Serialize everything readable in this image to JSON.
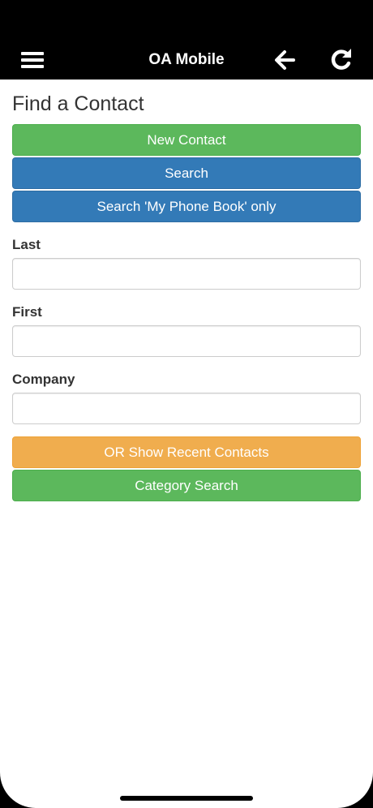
{
  "header": {
    "title": "OA Mobile",
    "menu_icon": "hamburger-menu-icon",
    "back_icon": "arrow-left-icon",
    "refresh_icon": "refresh-icon",
    "background": "#000000"
  },
  "page": {
    "title": "Find a Contact"
  },
  "buttons": {
    "new_contact": "New Contact",
    "search": "Search",
    "search_phone_book": "Search 'My Phone Book' only",
    "recent_contacts": "OR Show Recent Contacts",
    "category_search": "Category Search"
  },
  "form": {
    "last": {
      "label": "Last",
      "value": "",
      "placeholder": ""
    },
    "first": {
      "label": "First",
      "value": "",
      "placeholder": ""
    },
    "company": {
      "label": "Company",
      "value": "",
      "placeholder": ""
    }
  },
  "colors": {
    "success": "#5cb85c",
    "primary": "#337ab7",
    "warning": "#f0ad4e"
  }
}
